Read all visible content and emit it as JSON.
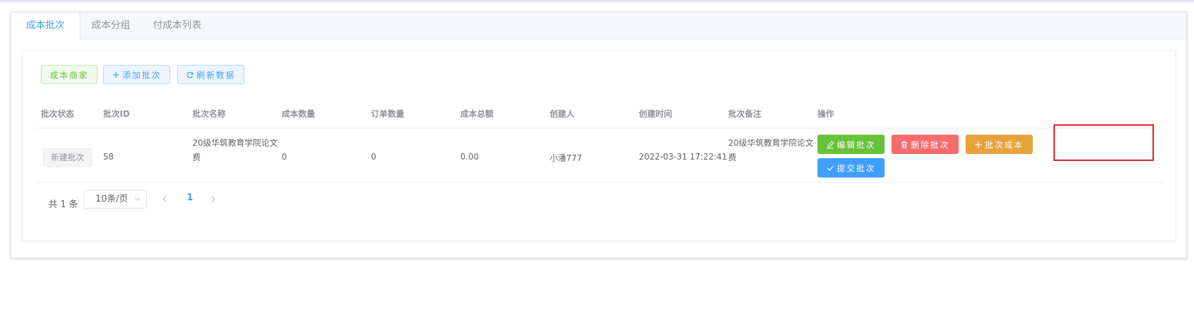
{
  "tabs": [
    {
      "label": "成本批次",
      "active": true
    },
    {
      "label": "成本分组",
      "active": false
    },
    {
      "label": "付成本列表",
      "active": false
    }
  ],
  "toolbar": {
    "merchant_label": "成本商家",
    "add_batch_label": "添加批次",
    "refresh_label": "刷新数据"
  },
  "table": {
    "headers": [
      "批次状态",
      "批次ID",
      "批次名称",
      "成本数量",
      "订单数量",
      "成本总额",
      "创建人",
      "创建时间",
      "批次备注",
      "操作"
    ],
    "rows": [
      {
        "status": "新建批次",
        "batch_id": "58",
        "name_line1": "20级华筑教育学院论文",
        "name_line2": "费",
        "cost_count": "0",
        "order_count": "0",
        "cost_total": "0.00",
        "creator": "小潘777",
        "created_at": "2022-03-31 17:22:41",
        "remark_line1": "20级华筑教育学院论文",
        "remark_line2": "费",
        "actions": {
          "edit": "编辑批次",
          "delete": "删除批次",
          "batch_cost": "批次成本",
          "submit": "提交批次"
        }
      }
    ]
  },
  "pagination": {
    "total": "共 1 条",
    "page_size": "10条/页",
    "current_page": "1"
  },
  "colors": {
    "primary": "#409eff",
    "success": "#67c23a",
    "danger": "#f56c6c",
    "warning": "#e6a23c",
    "highlight": "#e02020"
  },
  "icons": [
    "plus-icon",
    "refresh-icon",
    "edit-icon",
    "delete-icon",
    "check-icon",
    "chevron-down-icon",
    "chevron-left-icon",
    "chevron-right-icon"
  ]
}
